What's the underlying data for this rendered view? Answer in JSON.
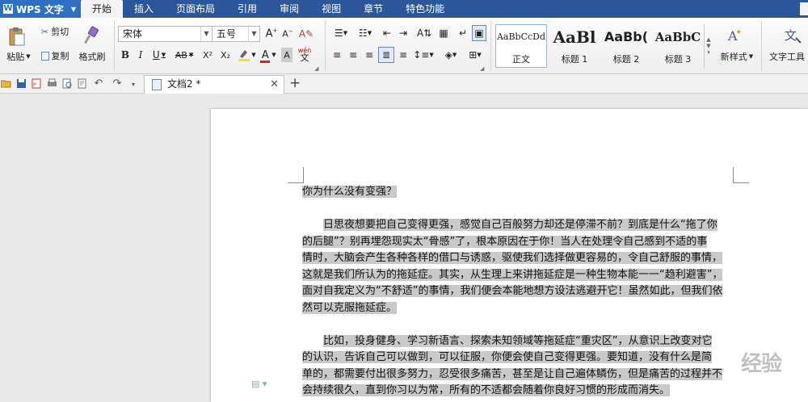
{
  "app": {
    "name": "WPS 文字"
  },
  "menu": {
    "tabs": [
      "开始",
      "插入",
      "页面布局",
      "引用",
      "审阅",
      "视图",
      "章节",
      "特色功能"
    ],
    "active_tab": "开始"
  },
  "ribbon": {
    "clipboard": {
      "paste": "粘贴",
      "cut": "剪切",
      "copy": "复制",
      "format_painter": "格式刷"
    },
    "font": {
      "name": "宋体",
      "size": "五号",
      "bold": "B",
      "italic": "I",
      "underline": "U",
      "strikethrough": "AB",
      "superscript": "X²",
      "subscript": "X₂",
      "font_color": "A",
      "char_shading": "A",
      "phonetic_guide": "wén\n文"
    },
    "styles": [
      {
        "sample": "AaBbCcDd",
        "name": "正文"
      },
      {
        "sample": "AaBl",
        "name": "标题 1"
      },
      {
        "sample": "AaBb(",
        "name": "标题 2"
      },
      {
        "sample": "AaBbC",
        "name": "标题 3"
      }
    ],
    "new_style": "新样式",
    "text_tools": "文字工具"
  },
  "document": {
    "tab_title": "文档2 *",
    "title_line": "你为什么没有变强？",
    "paragraphs": [
      [
        "日思夜想要把自己变得更强，感觉自己百般努力却还是停滞不前？到底是什么“拖了你",
        "的后腿”？别再埋怨现实太“骨感”了，根本原因在于你！当人在处理令自己感到不适的事",
        "情时，大脑会产生各种各样的借口与诱惑，驱使我们选择做更容易的，令自己舒服的事情，",
        "这就是我们所认为的拖延症。其实，从生理上来讲拖延症是一种生物本能一一“趋利避害”，",
        "面对自我定义为“不舒适”的事情，我们便会本能地想方设法逃避开它！虽然如此，但我们依",
        "然可以克服拖延症。"
      ],
      [
        "比如，投身健身、学习新语言、探索未知领域等拖延症“重灾区”，从意识上改变对它",
        "的认识，告诉自己可以做到，可以征服，你便会使自己变得更强。要知道，没有什么是简",
        "单的，都需要付出很多努力，忍受很多痛苦，甚至是让自己遍体鳞伤，但是痛苦的过程并不",
        "会持续很久，直到你习以为常，所有的不适都会随着你良好习惯的形成而消失。"
      ]
    ],
    "watermark": "经验"
  },
  "colors": {
    "menubar": "#2b579a",
    "app_button": "#2e6fc4",
    "selection": "#c9c9c9",
    "font_color_bar": "#e02020",
    "highlight_bar": "#f5e31a"
  }
}
